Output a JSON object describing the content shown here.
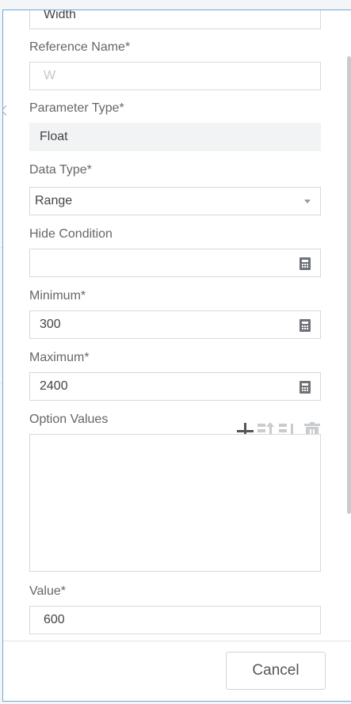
{
  "form": {
    "name_value": "Width",
    "reference_name": {
      "label": "Reference Name*",
      "placeholder": "W"
    },
    "parameter_type": {
      "label": "Parameter Type*",
      "value": "Float"
    },
    "data_type": {
      "label": "Data Type*",
      "value": "Range"
    },
    "hide_condition": {
      "label": "Hide Condition",
      "value": ""
    },
    "minimum": {
      "label": "Minimum*",
      "value": "300"
    },
    "maximum": {
      "label": "Maximum*",
      "value": "2400"
    },
    "option_values": {
      "label": "Option Values",
      "items": []
    },
    "value": {
      "label": "Value*",
      "value": "600"
    }
  },
  "footer": {
    "cancel_label": "Cancel"
  },
  "icons": {
    "calculator": "calculator-icon",
    "add": "plus-icon",
    "move_up": "move-up-icon",
    "move_down": "move-down-icon",
    "delete": "trash-icon",
    "dropdown": "chevron-down-icon"
  },
  "colors": {
    "panel_border": "#6fa8dc",
    "disabled_icon": "#c9cbcd"
  }
}
